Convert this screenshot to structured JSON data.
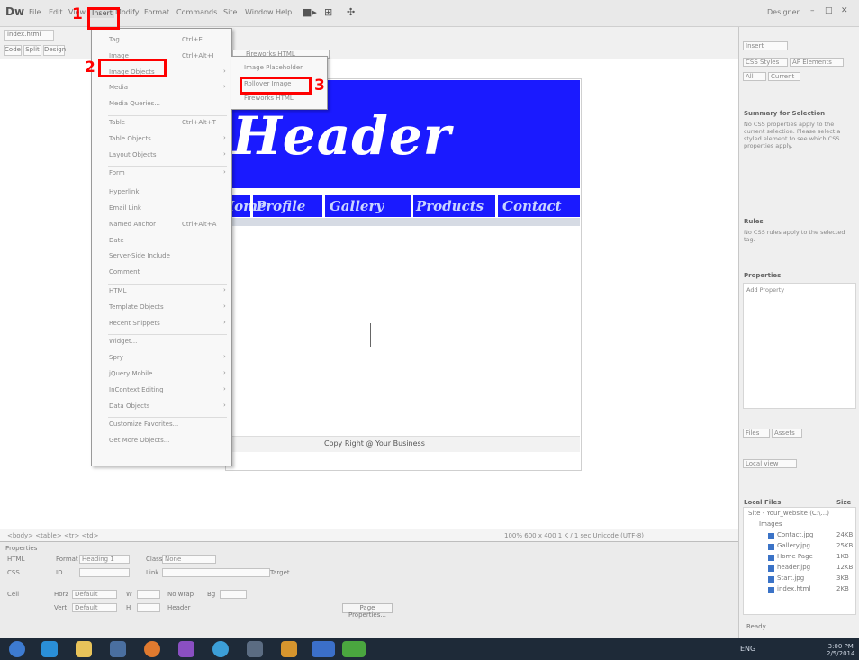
{
  "app": {
    "logo": "Dw",
    "menus": [
      "File",
      "Edit",
      "View",
      "Insert",
      "Modify",
      "Format",
      "Commands",
      "Site",
      "Window",
      "Help"
    ],
    "workspace": "Designer",
    "window_controls": [
      "–",
      "□",
      "✕"
    ]
  },
  "document": {
    "tab_label": "index.html",
    "view_buttons": [
      "Code",
      "Split",
      "Design"
    ]
  },
  "page": {
    "header_text": "Header",
    "nav_items": [
      "Home",
      "Profile",
      "Gallery",
      "Products",
      "Contact"
    ],
    "footer_text": "Copy Right @ Your Business"
  },
  "status_bar": {
    "tag_path": "<body> <table> <tr> <td>",
    "right_info": "100% 600 x 400 1 K / 1 sec Unicode (UTF-8)"
  },
  "properties": {
    "title": "Properties",
    "labels": [
      "HTML",
      "CSS",
      "Format",
      "Class",
      "ID",
      "Link",
      "Cell",
      "Horz",
      "Vert",
      "W",
      "H",
      "No wrap",
      "Bg",
      "Target",
      "Header"
    ],
    "format_value": "Heading 1",
    "class_value": "None",
    "horz_value": "Default",
    "vert_value": "Default",
    "page_props_button": "Page Properties..."
  },
  "insert_menu": {
    "items": [
      {
        "label": "Tag...",
        "shortcut": "Ctrl+E",
        "arrow": false,
        "sep_after": false
      },
      {
        "label": "Image",
        "shortcut": "Ctrl+Alt+I",
        "arrow": false,
        "sep_after": false
      },
      {
        "label": "Image Objects",
        "shortcut": "",
        "arrow": true,
        "sep_after": false
      },
      {
        "label": "Media",
        "shortcut": "",
        "arrow": true,
        "sep_after": false
      },
      {
        "label": "Media Queries...",
        "shortcut": "",
        "arrow": false,
        "sep_after": true
      },
      {
        "label": "Table",
        "shortcut": "Ctrl+Alt+T",
        "arrow": false,
        "sep_after": false
      },
      {
        "label": "Table Objects",
        "shortcut": "",
        "arrow": true,
        "sep_after": false
      },
      {
        "label": "Layout Objects",
        "shortcut": "",
        "arrow": true,
        "sep_after": true
      },
      {
        "label": "Form",
        "shortcut": "",
        "arrow": true,
        "sep_after": true
      },
      {
        "label": "Hyperlink",
        "shortcut": "",
        "arrow": false,
        "sep_after": false
      },
      {
        "label": "Email Link",
        "shortcut": "",
        "arrow": false,
        "sep_after": false
      },
      {
        "label": "Named Anchor",
        "shortcut": "Ctrl+Alt+A",
        "arrow": false,
        "sep_after": false
      },
      {
        "label": "Date",
        "shortcut": "",
        "arrow": false,
        "sep_after": false
      },
      {
        "label": "Server-Side Include",
        "shortcut": "",
        "arrow": false,
        "sep_after": false
      },
      {
        "label": "Comment",
        "shortcut": "",
        "arrow": false,
        "sep_after": true
      },
      {
        "label": "HTML",
        "shortcut": "",
        "arrow": true,
        "sep_after": false
      },
      {
        "label": "Template Objects",
        "shortcut": "",
        "arrow": true,
        "sep_after": false
      },
      {
        "label": "Recent Snippets",
        "shortcut": "",
        "arrow": true,
        "sep_after": true
      },
      {
        "label": "Widget...",
        "shortcut": "",
        "arrow": false,
        "sep_after": false
      },
      {
        "label": "Spry",
        "shortcut": "",
        "arrow": true,
        "sep_after": false
      },
      {
        "label": "jQuery Mobile",
        "shortcut": "",
        "arrow": true,
        "sep_after": false
      },
      {
        "label": "InContext Editing",
        "shortcut": "",
        "arrow": true,
        "sep_after": false
      },
      {
        "label": "Data Objects",
        "shortcut": "",
        "arrow": true,
        "sep_after": true
      },
      {
        "label": "Customize Favorites...",
        "shortcut": "",
        "arrow": false,
        "sep_after": false
      },
      {
        "label": "Get More Objects...",
        "shortcut": "",
        "arrow": false,
        "sep_after": false
      }
    ]
  },
  "image_objects_submenu": {
    "top_item": "Fireworks HTML",
    "items": [
      "Image Placeholder",
      "Rollover Image",
      "Fireworks HTML"
    ]
  },
  "annotations": [
    {
      "number": "1"
    },
    {
      "number": "2"
    },
    {
      "number": "3"
    }
  ],
  "right_panel": {
    "tabs": [
      "Insert",
      "CSS Styles",
      "AP Elements"
    ],
    "css_tabs": [
      "All",
      "Current"
    ],
    "rules_title": "Summary for Selection",
    "rules_text": "No CSS properties apply to the current selection. Please select a styled element to see which CSS properties apply.",
    "rules_heading": "Rules",
    "rules_info": "No CSS rules apply to the selected tag.",
    "properties_heading": "Properties",
    "properties_info": "Add Property",
    "files_tabs": [
      "Files",
      "Assets"
    ],
    "files_toolbar": "Local view",
    "files_header": "Local Files",
    "files_size_header": "Size",
    "site_root": "Site - Your_website (C:\\...)",
    "folder": "Images",
    "files": [
      {
        "name": "Contact.jpg",
        "size": "24KB"
      },
      {
        "name": "Gallery.jpg",
        "size": "25KB"
      },
      {
        "name": "Home Page",
        "size": "1KB"
      },
      {
        "name": "header.jpg",
        "size": "12KB"
      },
      {
        "name": "Start.jpg",
        "size": "3KB"
      },
      {
        "name": "index.html",
        "size": "2KB"
      }
    ],
    "footer": "Ready"
  },
  "taskbar": {
    "tray_text": "ENG",
    "clock_time": "3:00 PM",
    "clock_date": "2/5/2014"
  },
  "colors": {
    "highlight": "#ff0000",
    "header_blue": "#1a1aff"
  }
}
